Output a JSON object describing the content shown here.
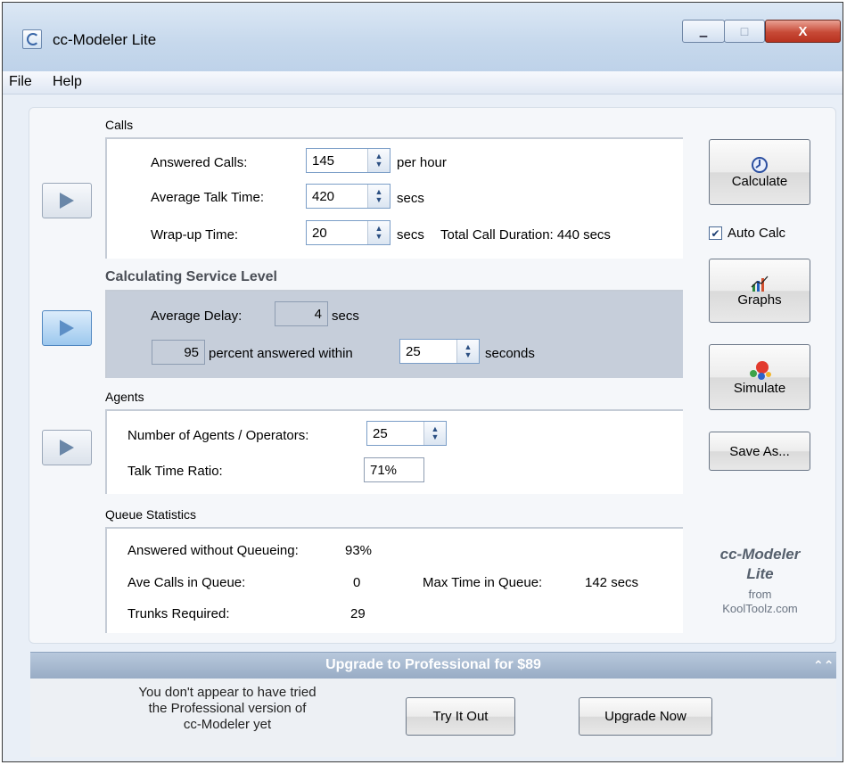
{
  "window": {
    "title": "cc-Modeler Lite",
    "controls": {
      "minimize": "▁",
      "maximize": "□",
      "close": "X"
    }
  },
  "menu": {
    "file": "File",
    "help": "Help"
  },
  "calls": {
    "title": "Calls",
    "answered_label": "Answered Calls:",
    "answered_value": "145",
    "answered_unit": "per hour",
    "talk_label": "Average Talk Time:",
    "talk_value": "420",
    "talk_unit": "secs",
    "wrap_label": "Wrap-up Time:",
    "wrap_value": "20",
    "wrap_unit": "secs",
    "total_duration": "Total Call Duration: 440 secs"
  },
  "service_level": {
    "title": "Calculating Service Level",
    "delay_label": "Average Delay:",
    "delay_value": "4",
    "delay_unit": "secs",
    "percent_value": "95",
    "percent_text": "percent answered within",
    "within_value": "25",
    "within_unit": "seconds"
  },
  "agents": {
    "title": "Agents",
    "num_label": "Number of Agents / Operators:",
    "num_value": "25",
    "ratio_label": "Talk Time Ratio:",
    "ratio_value": "71%"
  },
  "queue": {
    "title": "Queue Statistics",
    "answered_label": "Answered without Queueing:",
    "answered_value": "93%",
    "ave_label": "Ave Calls in Queue:",
    "ave_value": "0",
    "max_label": "Max Time in Queue:",
    "max_value": "142 secs",
    "trunks_label": "Trunks Required:",
    "trunks_value": "29"
  },
  "side": {
    "calculate": "Calculate",
    "auto_calc": "Auto Calc",
    "auto_calc_checked": true,
    "graphs": "Graphs",
    "simulate": "Simulate",
    "save_as": "Save As..."
  },
  "brand": {
    "line1": "cc-Modeler",
    "line2": "Lite",
    "line3": "from",
    "line4": "KoolToolz.com"
  },
  "upgrade": {
    "title": "Upgrade to Professional for $89",
    "collapse_icon": "⌃⌃",
    "message_line1": "You don't appear to have tried",
    "message_line2": "the Professional version of",
    "message_line3": "cc-Modeler yet",
    "try_button": "Try It Out",
    "upgrade_button": "Upgrade Now"
  }
}
